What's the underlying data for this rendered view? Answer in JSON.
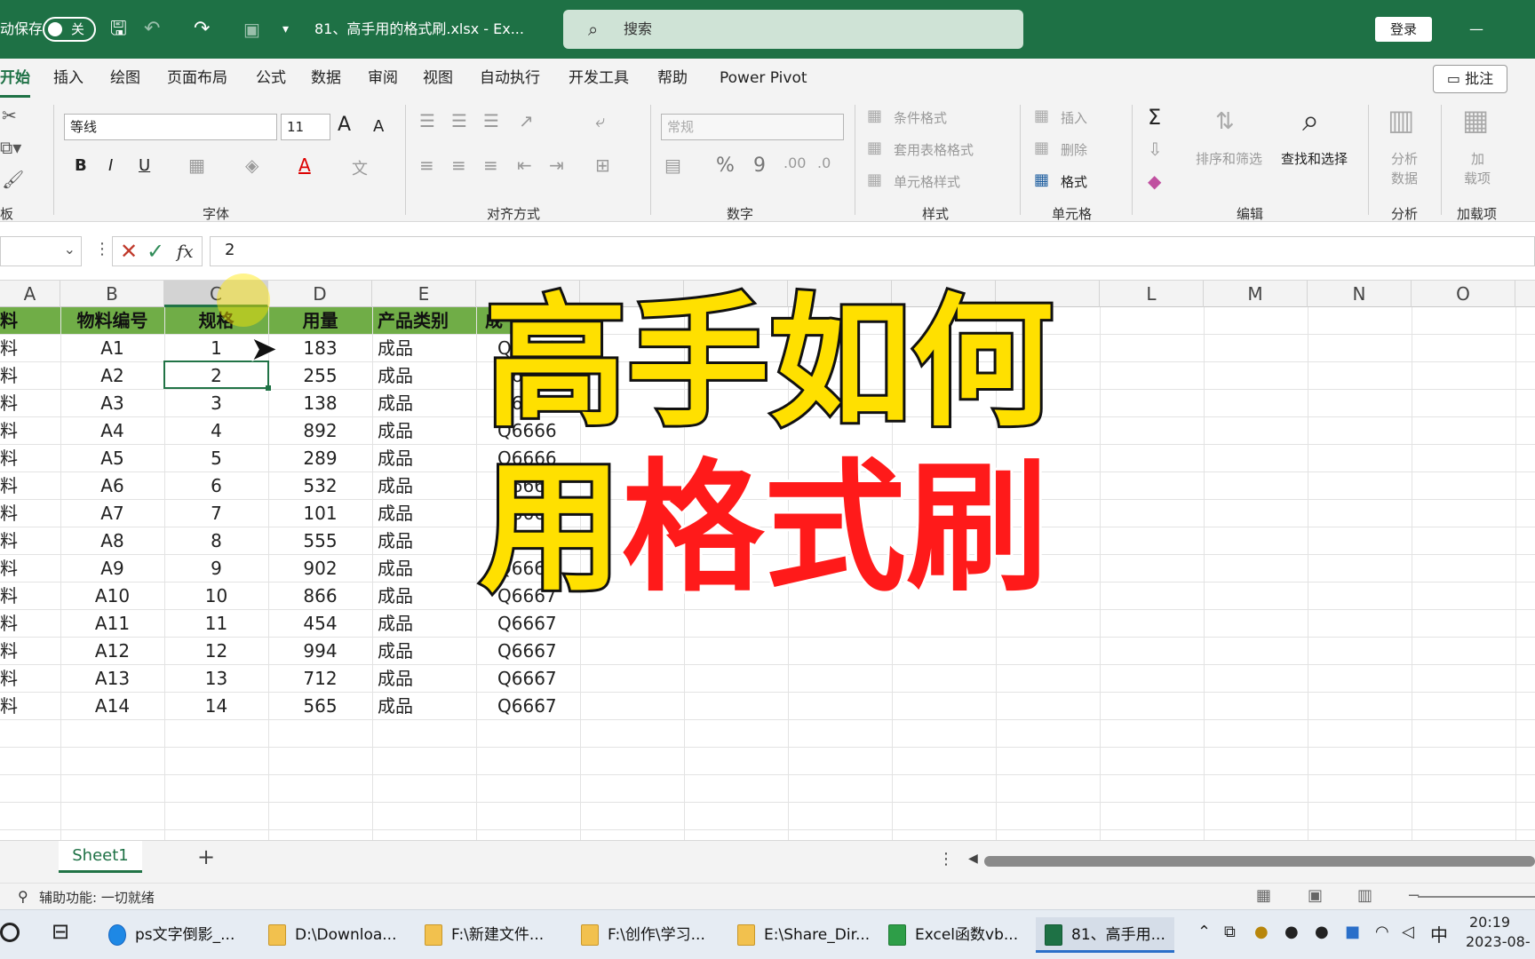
{
  "titlebar": {
    "autosave_label": "动保存",
    "autosave_state": "关",
    "doc_title": "81、高手用的格式刷.xlsx  -  Ex...",
    "search_label": "搜索",
    "login_label": "登录",
    "minimize": "—"
  },
  "tabs": [
    "开始",
    "插入",
    "绘图",
    "页面布局",
    "公式",
    "数据",
    "审阅",
    "视图",
    "自动执行",
    "开发工具",
    "帮助",
    "Power Pivot"
  ],
  "comment_label": "批注",
  "ribbon": {
    "font_name": "等线",
    "font_size": "11",
    "grow": "A",
    "shrink": "A",
    "bold": "B",
    "italic": "I",
    "underline": "U",
    "font_color_glyph": "A",
    "wen": "文",
    "number_format": "常规",
    "percent": "%",
    "comma": "9",
    "cond_format": "条件格式",
    "table_format": "套用表格格式",
    "cell_style": "单元格样式",
    "insert": "插入",
    "delete": "删除",
    "format": "格式",
    "sum": "Σ",
    "sort_filter": "排序和筛选",
    "find_select": "查找和选择",
    "analyze_data_1": "分析",
    "analyze_data_2": "数据",
    "addin_1": "加",
    "addin_2": "载项",
    "groups": {
      "clipboard": "板",
      "font": "字体",
      "align": "对齐方式",
      "number": "数字",
      "styles": "样式",
      "cells": "单元格",
      "editing": "编辑",
      "analysis": "分析",
      "addins": "加载项"
    }
  },
  "formula_bar": {
    "fx": "fx",
    "value": "2"
  },
  "columns": [
    "A",
    "B",
    "C",
    "D",
    "E",
    "",
    "",
    "",
    "",
    "",
    "",
    "L",
    "M",
    "N",
    "O"
  ],
  "header_row": [
    "料",
    "物料编号",
    "规格",
    "用量",
    "产品类别",
    "成"
  ],
  "rows": [
    [
      "料",
      "A1",
      "1",
      "183",
      "成品",
      "Q6666"
    ],
    [
      "料",
      "A2",
      "2",
      "255",
      "成品",
      "Q6666"
    ],
    [
      "料",
      "A3",
      "3",
      "138",
      "成品",
      "Q6666"
    ],
    [
      "料",
      "A4",
      "4",
      "892",
      "成品",
      "Q6666"
    ],
    [
      "料",
      "A5",
      "5",
      "289",
      "成品",
      "Q6666"
    ],
    [
      "料",
      "A6",
      "6",
      "532",
      "成品",
      "Q6666"
    ],
    [
      "料",
      "A7",
      "7",
      "101",
      "成品",
      "Q6667"
    ],
    [
      "料",
      "A8",
      "8",
      "555",
      "成品",
      "Q6667"
    ],
    [
      "料",
      "A9",
      "9",
      "902",
      "成品",
      "Q6667"
    ],
    [
      "料",
      "A10",
      "10",
      "866",
      "成品",
      "Q6667"
    ],
    [
      "料",
      "A11",
      "11",
      "454",
      "成品",
      "Q6667"
    ],
    [
      "料",
      "A12",
      "12",
      "994",
      "成品",
      "Q6667"
    ],
    [
      "料",
      "A13",
      "13",
      "712",
      "成品",
      "Q6667"
    ],
    [
      "料",
      "A14",
      "14",
      "565",
      "成品",
      "Q6667"
    ]
  ],
  "overlay": {
    "line1": "高手如何",
    "line2_a": "用",
    "line2_b": "格式刷"
  },
  "sheet_tab": "Sheet1",
  "add_sheet": "+",
  "status": "辅助功能: 一切就绪",
  "taskbar": {
    "items": [
      "ps文字倒影_...",
      "D:\\Downloa...",
      "F:\\新建文件...",
      "F:\\创作\\学习...",
      "E:\\Share_Dir...",
      "Excel函数vb...",
      "81、高手用..."
    ],
    "ime": "中",
    "time": "20:19",
    "date": "2023-08-"
  },
  "colors": {
    "excel_green": "#1e7145",
    "header_fill": "#70ad47",
    "overlay_yellow": "#ffe000",
    "overlay_red": "#ff1a1a"
  }
}
